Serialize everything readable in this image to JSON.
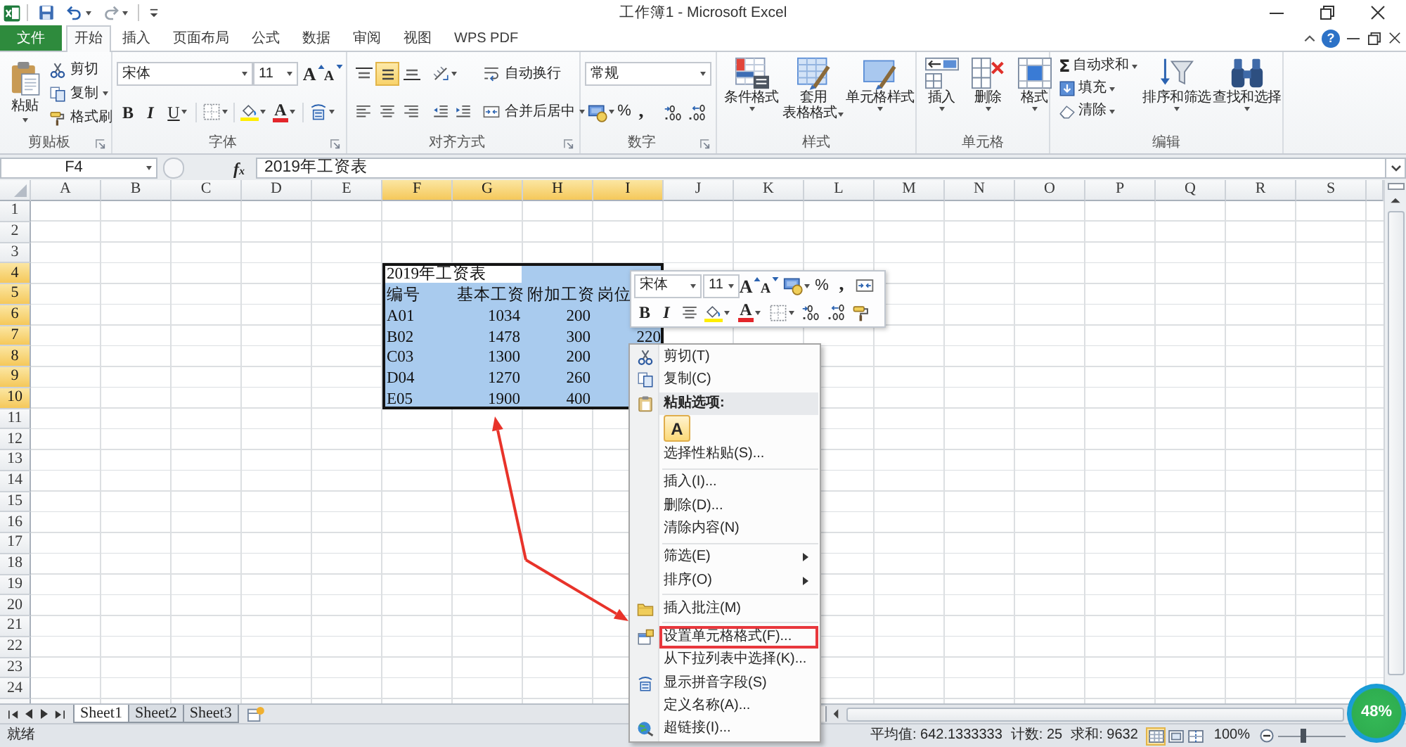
{
  "title_bar": {
    "title": "工作簿1 - Microsoft Excel"
  },
  "ribbon_tabs": [
    {
      "label": "文件",
      "kind": "file",
      "selected": false
    },
    {
      "label": "开始",
      "kind": "tab",
      "selected": true
    },
    {
      "label": "插入",
      "kind": "tab",
      "selected": false
    },
    {
      "label": "页面布局",
      "kind": "tab",
      "selected": false
    },
    {
      "label": "公式",
      "kind": "tab",
      "selected": false
    },
    {
      "label": "数据",
      "kind": "tab",
      "selected": false
    },
    {
      "label": "审阅",
      "kind": "tab",
      "selected": false
    },
    {
      "label": "视图",
      "kind": "tab",
      "selected": false
    },
    {
      "label": "WPS PDF",
      "kind": "tab",
      "selected": false
    }
  ],
  "help_button": "?",
  "clipboard_group": {
    "label": "剪贴板",
    "paste": "粘贴",
    "cut": "剪切",
    "copy": "复制",
    "format_painter": "格式刷"
  },
  "font_group": {
    "label": "字体",
    "font_name": "宋体",
    "font_size": "11",
    "grow_font": "A",
    "shrink_font": "A",
    "bold": "B",
    "italic": "I",
    "underline": "U",
    "font_color": "A"
  },
  "alignment_group": {
    "label": "对齐方式",
    "vertical_align": [
      {
        "selected": false
      },
      {
        "selected": true
      },
      {
        "selected": false
      }
    ],
    "wrap_text": "自动换行",
    "merge_center": "合并后居中"
  },
  "number_group": {
    "label": "数字",
    "format": "常规",
    "percent": "%",
    "comma": ","
  },
  "styles_group": {
    "label": "样式",
    "conditional_formatting": "条件格式",
    "format_as_table": [
      "套用",
      "表格格式"
    ],
    "cell_styles": "单元格样式"
  },
  "cells_group": {
    "label": "单元格",
    "insert": "插入",
    "delete": "删除",
    "format": "格式"
  },
  "editing_group": {
    "label": "编辑",
    "sigma": "Σ",
    "autosum": "自动求和",
    "fill": "填充",
    "clear": "清除",
    "sort_filter": "排序和筛选",
    "find_select": "查找和选择"
  },
  "formula_bar": {
    "name_box": "F4",
    "fx": "f$_{x}$",
    "formula": "2019年工资表"
  },
  "sheet": {
    "columns": [
      {
        "label": "A",
        "selected": false
      },
      {
        "label": "B",
        "selected": false
      },
      {
        "label": "C",
        "selected": false
      },
      {
        "label": "D",
        "selected": false
      },
      {
        "label": "E",
        "selected": false
      },
      {
        "label": "F",
        "selected": true
      },
      {
        "label": "G",
        "selected": true
      },
      {
        "label": "H",
        "selected": true
      },
      {
        "label": "I",
        "selected": true
      },
      {
        "label": "J",
        "selected": false
      },
      {
        "label": "K",
        "selected": false
      },
      {
        "label": "L",
        "selected": false
      },
      {
        "label": "M",
        "selected": false
      },
      {
        "label": "N",
        "selected": false
      },
      {
        "label": "O",
        "selected": false
      },
      {
        "label": "P",
        "selected": false
      },
      {
        "label": "Q",
        "selected": false
      },
      {
        "label": "R",
        "selected": false
      },
      {
        "label": "S",
        "selected": false
      }
    ],
    "rows": [
      {
        "label": "1",
        "selected": false
      },
      {
        "label": "2",
        "selected": false
      },
      {
        "label": "3",
        "selected": false
      },
      {
        "label": "4",
        "selected": true,
        "cells": [
          {
            "value": "2019年工资表",
            "kind": "text",
            "active": true
          }
        ]
      },
      {
        "label": "5",
        "selected": true,
        "cells": [
          {
            "value": "编号",
            "kind": "text",
            "active": false
          },
          {
            "value": "基本工资",
            "kind": "text",
            "active": false
          },
          {
            "value": "附加工资",
            "kind": "text",
            "active": false
          },
          {
            "value": "岗位",
            "kind": "text",
            "active": false
          }
        ]
      },
      {
        "label": "6",
        "selected": true,
        "cells": [
          {
            "value": "A01",
            "kind": "text",
            "active": false
          },
          {
            "value": "1034",
            "kind": "number",
            "active": false
          },
          {
            "value": "200",
            "kind": "number",
            "active": false
          }
        ]
      },
      {
        "label": "7",
        "selected": true,
        "cells": [
          {
            "value": "B02",
            "kind": "text",
            "active": false
          },
          {
            "value": "1478",
            "kind": "number",
            "active": false
          },
          {
            "value": "300",
            "kind": "number",
            "active": false
          },
          {
            "value": "220",
            "kind": "number",
            "active": false
          }
        ]
      },
      {
        "label": "8",
        "selected": true,
        "cells": [
          {
            "value": "C03",
            "kind": "text",
            "active": false
          },
          {
            "value": "1300",
            "kind": "number",
            "active": false
          },
          {
            "value": "200",
            "kind": "number",
            "active": false
          }
        ]
      },
      {
        "label": "9",
        "selected": true,
        "cells": [
          {
            "value": "D04",
            "kind": "text",
            "active": false
          },
          {
            "value": "1270",
            "kind": "number",
            "active": false
          },
          {
            "value": "260",
            "kind": "number",
            "active": false
          }
        ]
      },
      {
        "label": "10",
        "selected": true,
        "cells": [
          {
            "value": "E05",
            "kind": "text",
            "active": false
          },
          {
            "value": "1900",
            "kind": "number",
            "active": false
          },
          {
            "value": "400",
            "kind": "number",
            "active": false
          }
        ]
      },
      {
        "label": "11",
        "selected": false
      },
      {
        "label": "12",
        "selected": false
      },
      {
        "label": "13",
        "selected": false
      },
      {
        "label": "14",
        "selected": false
      },
      {
        "label": "15",
        "selected": false
      },
      {
        "label": "16",
        "selected": false
      },
      {
        "label": "17",
        "selected": false
      },
      {
        "label": "18",
        "selected": false
      },
      {
        "label": "19",
        "selected": false
      },
      {
        "label": "20",
        "selected": false
      },
      {
        "label": "21",
        "selected": false
      },
      {
        "label": "22",
        "selected": false
      },
      {
        "label": "23",
        "selected": false
      },
      {
        "label": "24",
        "selected": false
      }
    ]
  },
  "mini_toolbar": {
    "font_name": "宋体",
    "font_size": "11",
    "grow_font": "A",
    "shrink_font": "A",
    "percent": "%",
    "comma": ",",
    "bold": "B",
    "italic": "I",
    "font_color": "A"
  },
  "context_menu": [
    {
      "kind": "command",
      "label": "剪切(T)",
      "submenu": false,
      "highlighted": false
    },
    {
      "kind": "command",
      "label": "复制(C)",
      "submenu": false,
      "highlighted": false
    },
    {
      "kind": "header",
      "label": "粘贴选项:"
    },
    {
      "kind": "paste_option",
      "label": "A"
    },
    {
      "kind": "command",
      "label": "选择性粘贴(S)...",
      "submenu": false,
      "highlighted": false
    },
    {
      "kind": "separator"
    },
    {
      "kind": "command",
      "label": "插入(I)...",
      "submenu": false,
      "highlighted": false
    },
    {
      "kind": "command",
      "label": "删除(D)...",
      "submenu": false,
      "highlighted": false
    },
    {
      "kind": "command",
      "label": "清除内容(N)",
      "submenu": false,
      "highlighted": false
    },
    {
      "kind": "separator"
    },
    {
      "kind": "command",
      "label": "筛选(E)",
      "submenu": true,
      "highlighted": false
    },
    {
      "kind": "command",
      "label": "排序(O)",
      "submenu": true,
      "highlighted": false
    },
    {
      "kind": "separator"
    },
    {
      "kind": "command",
      "label": "插入批注(M)",
      "submenu": false,
      "highlighted": false
    },
    {
      "kind": "separator"
    },
    {
      "kind": "command",
      "label": "设置单元格格式(F)...",
      "submenu": false,
      "highlighted": true
    },
    {
      "kind": "command",
      "label": "从下拉列表中选择(K)...",
      "submenu": false,
      "highlighted": false
    },
    {
      "kind": "command",
      "label": "显示拼音字段(S)",
      "submenu": false,
      "highlighted": false
    },
    {
      "kind": "command",
      "label": "定义名称(A)...",
      "submenu": false,
      "highlighted": false
    },
    {
      "kind": "command",
      "label": "超链接(I)...",
      "submenu": false,
      "highlighted": false
    }
  ],
  "sheet_tabs": [
    {
      "label": "Sheet1",
      "selected": true
    },
    {
      "label": "Sheet2",
      "selected": false
    },
    {
      "label": "Sheet3",
      "selected": false
    }
  ],
  "status_bar": {
    "mode": "就绪",
    "average": "平均值: 642.1333333",
    "count": "计数: 25",
    "sum": "求和: 9632",
    "view_buttons": [
      {
        "selected": true
      },
      {
        "selected": false
      },
      {
        "selected": false
      }
    ],
    "zoom": "100%",
    "zoom_slider": {
      "level": 0.38
    }
  },
  "floating_widget": {
    "reading": "48%"
  }
}
